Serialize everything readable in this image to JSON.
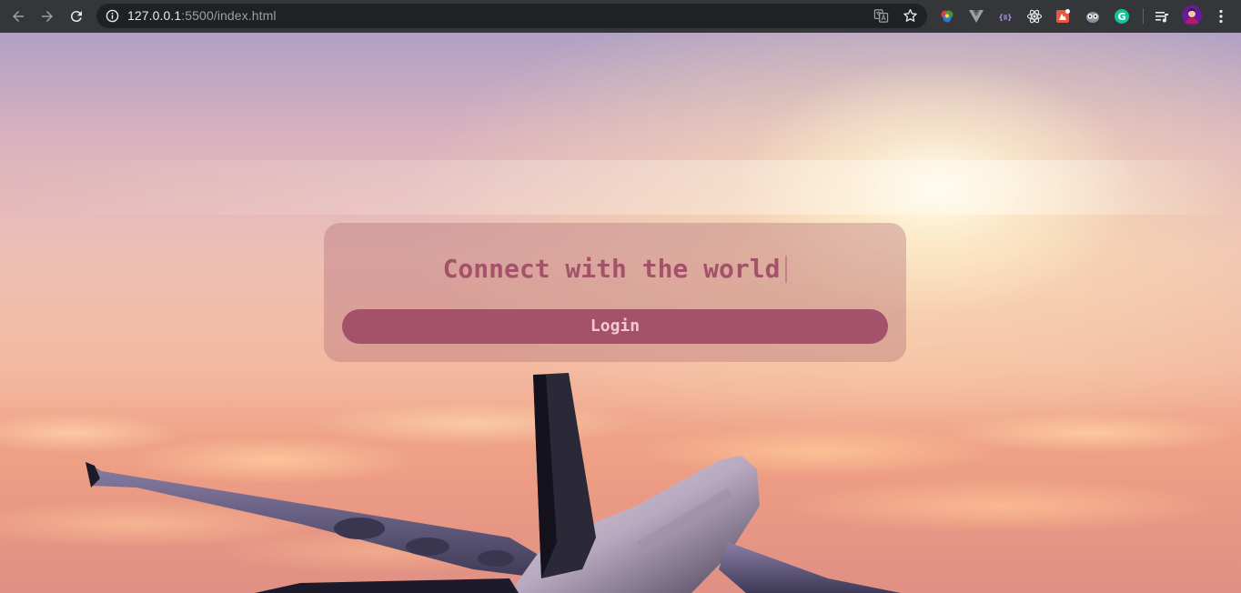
{
  "browser": {
    "url_host": "127.0.0.1",
    "url_rest": ":5500/index.html",
    "back_icon": "arrow-left-icon",
    "forward_icon": "arrow-right-icon",
    "reload_icon": "reload-icon",
    "extensions": [
      "color-picker-icon",
      "vue-devtools-icon",
      "json-viewer-icon",
      "react-devtools-icon",
      "ext-badge-icon",
      "owl-icon",
      "grammarly-icon"
    ],
    "grammarly_label": "G"
  },
  "page": {
    "headline": "Connect with the world",
    "login_label": "Login"
  },
  "colors": {
    "accent": "#a4526a",
    "button_text": "#f4c8d0",
    "toolbar": "#35363a"
  }
}
